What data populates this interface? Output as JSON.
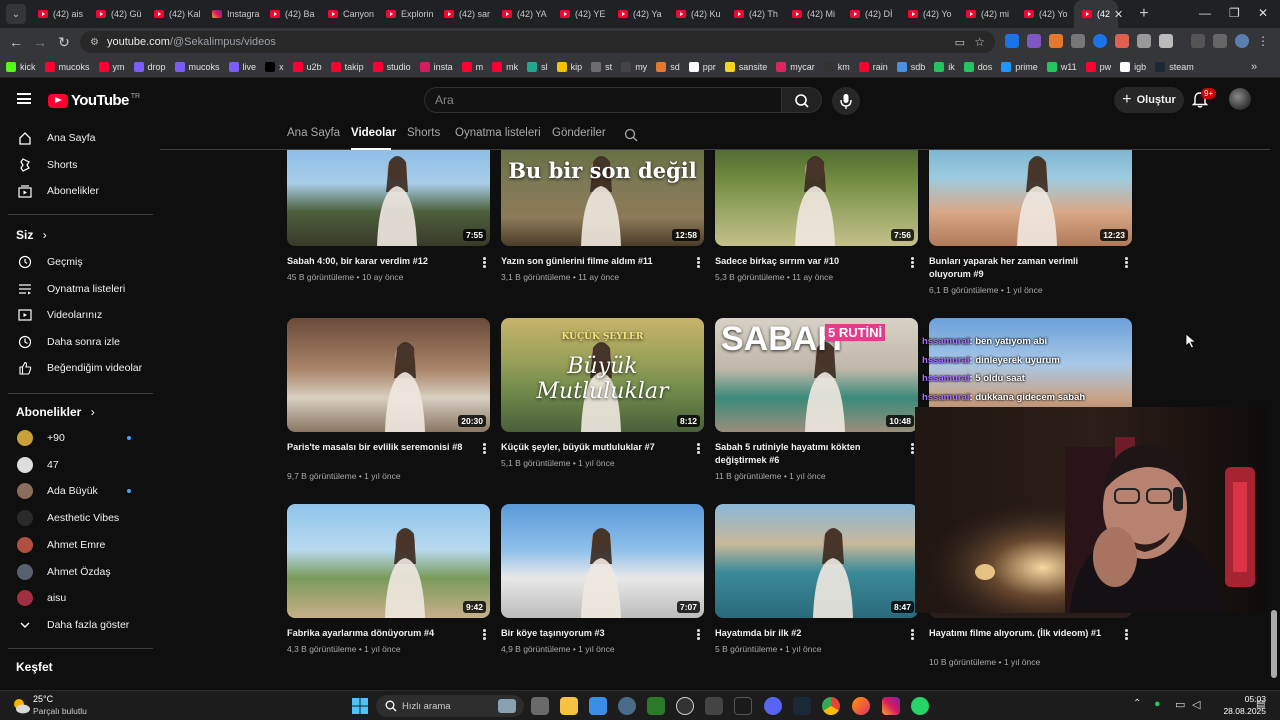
{
  "browser": {
    "tabs": [
      {
        "title": "(42) ais",
        "icon": "youtube"
      },
      {
        "title": "(42) Gü",
        "icon": "youtube"
      },
      {
        "title": "(42) Kal",
        "icon": "youtube"
      },
      {
        "title": "Instagra",
        "icon": "instagram"
      },
      {
        "title": "(42) Ba",
        "icon": "youtube"
      },
      {
        "title": "Canyon",
        "icon": "youtube"
      },
      {
        "title": "Explorin",
        "icon": "youtube"
      },
      {
        "title": "(42) sar",
        "icon": "youtube"
      },
      {
        "title": "(42) YA",
        "icon": "youtube"
      },
      {
        "title": "(42) YE",
        "icon": "youtube"
      },
      {
        "title": "(42) Ya",
        "icon": "youtube"
      },
      {
        "title": "(42) Ku",
        "icon": "youtube"
      },
      {
        "title": "(42) Th",
        "icon": "youtube"
      },
      {
        "title": "(42) Mi",
        "icon": "youtube"
      },
      {
        "title": "(42) Dİ",
        "icon": "youtube"
      },
      {
        "title": "(42) Yo",
        "icon": "youtube"
      },
      {
        "title": "(42) mi",
        "icon": "youtube"
      },
      {
        "title": "(42) Yo",
        "icon": "youtube"
      }
    ],
    "active_tab": {
      "title": "(42"
    },
    "url_host": "youtube.com",
    "url_path": "/@Sekalimpus/videos",
    "bookmarks": [
      {
        "label": "kick",
        "color": "#53fc18"
      },
      {
        "label": "mucoks",
        "color": "#ff0033"
      },
      {
        "label": "ym",
        "color": "#ff0033"
      },
      {
        "label": "drop",
        "color": "#7a5cff"
      },
      {
        "label": "mucoks",
        "color": "#7a5cff"
      },
      {
        "label": "live",
        "color": "#7a5cff"
      },
      {
        "label": "x",
        "color": "#000000"
      },
      {
        "label": "u2b",
        "color": "#ff0033"
      },
      {
        "label": "takip",
        "color": "#ff0033"
      },
      {
        "label": "studio",
        "color": "#ff0033"
      },
      {
        "label": "insta",
        "color": "#d81b60"
      },
      {
        "label": "m",
        "color": "#ff0033"
      },
      {
        "label": "mk",
        "color": "#ff0033"
      },
      {
        "label": "sl",
        "color": "#1faa8f"
      },
      {
        "label": "kip",
        "color": "#f5c400"
      },
      {
        "label": "st",
        "color": "#6e6e6e"
      },
      {
        "label": "my",
        "color": "#444444"
      },
      {
        "label": "sd",
        "color": "#e8772e"
      },
      {
        "label": "ppr",
        "color": "#ffffff"
      },
      {
        "label": "sansite",
        "color": "#f7d51d"
      },
      {
        "label": "mycar",
        "color": "#e0245e"
      },
      {
        "label": "km",
        "color": "#333333"
      },
      {
        "label": "rain",
        "color": "#ff0033"
      },
      {
        "label": "sdb",
        "color": "#4a90e2"
      },
      {
        "label": "ik",
        "color": "#22c55e"
      },
      {
        "label": "dos",
        "color": "#22c55e"
      },
      {
        "label": "prime",
        "color": "#1a98ff"
      },
      {
        "label": "w11",
        "color": "#22c55e"
      },
      {
        "label": "pw",
        "color": "#ff0033"
      },
      {
        "label": "igb",
        "color": "#ffffff"
      },
      {
        "label": "steam",
        "color": "#1b2838"
      }
    ]
  },
  "yt": {
    "logo_text": "YouTube",
    "country": "TR",
    "search_placeholder": "Ara",
    "create_label": "Oluştur",
    "notif_badge": "9+"
  },
  "sidebar": {
    "main": [
      {
        "label": "Ana Sayfa",
        "icon": "home-icon"
      },
      {
        "label": "Shorts",
        "icon": "shorts-icon"
      },
      {
        "label": "Abonelikler",
        "icon": "subscriptions-icon"
      }
    ],
    "you_header": "Siz",
    "you": [
      {
        "label": "Geçmiş",
        "icon": "history-icon"
      },
      {
        "label": "Oynatma listeleri",
        "icon": "playlists-icon"
      },
      {
        "label": "Videolarınız",
        "icon": "your-videos-icon"
      },
      {
        "label": "Daha sonra izle",
        "icon": "watch-later-icon"
      },
      {
        "label": "Beğendiğim videolar",
        "icon": "liked-icon"
      }
    ],
    "subs_header": "Abonelikler",
    "subs": [
      {
        "label": "+90",
        "live": true,
        "color": "#c8a13a"
      },
      {
        "label": "47",
        "live": false,
        "color": "#dddddd"
      },
      {
        "label": "Ada Büyük",
        "live": true,
        "color": "#8a6e5a"
      },
      {
        "label": "Aesthetic Vibes",
        "live": false,
        "color": "#2a2a2a"
      },
      {
        "label": "Ahmet Emre",
        "live": false,
        "color": "#b05040"
      },
      {
        "label": "Ahmet Özdaş",
        "live": false,
        "color": "#556070"
      },
      {
        "label": "aisu",
        "live": false,
        "color": "#a03040"
      }
    ],
    "show_more": "Daha fazla göster",
    "explore_header": "Keşfet"
  },
  "channel_tabs": [
    "Ana Sayfa",
    "Videolar",
    "Shorts",
    "Oynatma listeleri",
    "Gönderiler"
  ],
  "videos": [
    {
      "title": "Sabah 4:00, bir karar verdim #12",
      "views": "45 B görüntüleme",
      "age": "10 ay önce",
      "duration": "7:55",
      "thumb_text": "",
      "bg": "linear-gradient(180deg,#7fb6e6 0%,#a8cde8 45%,#4b5f3a 70%,#3a3a2a 100%)"
    },
    {
      "title": "Yazın son günlerini filme aldım #11",
      "views": "3,1 B görüntüleme",
      "age": "11 ay önce",
      "duration": "12:58",
      "thumb_text": "Bu bir son değil",
      "bg": "linear-gradient(180deg,#5b6a3a 0%,#7d7a55 45%,#8d7a58 75%,#4a3d2a 100%)"
    },
    {
      "title": "Sadece birkaç sırrım var #10",
      "views": "5,3 B görüntüleme",
      "age": "11 ay önce",
      "duration": "7:56",
      "thumb_text": "",
      "bg": "linear-gradient(180deg,#3e5a2a 0%,#6f8a3e 40%,#9aa866 70%,#c4c08a 100%)"
    },
    {
      "title": "Bunları yaparak her zaman verimli oluyorum #9",
      "views": "6,1 B görüntüleme",
      "age": "1 yıl önce",
      "duration": "12:23",
      "thumb_text": "",
      "bg": "linear-gradient(180deg,#6aa8c8 0%,#9ccbe0 40%,#d8a886 70%,#b07a5a 100%)"
    },
    {
      "title": "Paris'te masalsı bir evlilik seremonisi #8",
      "views": "9,7 B görüntüleme",
      "age": "1 yıl önce",
      "duration": "20:30",
      "thumb_text": "",
      "bg": "linear-gradient(180deg,#6a4a3a 0%,#a88468 45%,#d8cfc2 70%,#8a7664 100%)"
    },
    {
      "title": "Küçük şeyler, büyük mutluluklar #7",
      "views": "5,1 B görüntüleme",
      "age": "1 yıl önce",
      "duration": "8:12",
      "thumb_text": "Büyük Mutluluklar",
      "bg": "linear-gradient(180deg,#c8b46a 0%,#9ca25a 35%,#6e8a4a 65%,#4a5f3a 100%)"
    },
    {
      "title": "Sabah 5 rutiniyle hayatımı kökten değiştirmek #6",
      "views": "11 B görüntüleme",
      "age": "1 yıl önce",
      "duration": "10:48",
      "thumb_text": "SABAH",
      "bg": "linear-gradient(180deg,#d8d2c6 0%,#bfb7a8 45%,#3a8a7a 70%,#9a8e7a 100%)"
    },
    {
      "title": "",
      "views": "",
      "age": "",
      "duration": "",
      "thumb_text": "",
      "bg": "linear-gradient(180deg,#6aa0d8 0%,#a8c8e8 40%,#c8a486 70%,#a86a5a 100%)"
    },
    {
      "title": "Fabrika ayarlarıma dönüyorum #4",
      "views": "4,3 B görüntüleme",
      "age": "1 yıl önce",
      "duration": "9:42",
      "thumb_text": "",
      "bg": "linear-gradient(180deg,#8ec4ea 0%,#b8daf0 40%,#7a9a5a 65%,#c8b08a 100%)"
    },
    {
      "title": "Bir köye taşınıyorum #3",
      "views": "4,9 B görüntüleme",
      "age": "1 yıl önce",
      "duration": "7:07",
      "thumb_text": "",
      "bg": "linear-gradient(180deg,#5a9ad8 0%,#8ec0ea 40%,#e8e8e8 65%,#bcbcbc 100%)"
    },
    {
      "title": "Hayatımda bir ilk #2",
      "views": "5 B görüntüleme",
      "age": "1 yıl önce",
      "duration": "8:47",
      "thumb_text": "",
      "bg": "linear-gradient(180deg,#8ab8d8 0%,#c8b89a 35%,#3a8a9a 60%,#2a6a7a 100%)"
    },
    {
      "title": "Hayatımı filme alıyorum. (İlk videom) #1",
      "views": "10 B görüntüleme",
      "age": "1 yıl önce",
      "duration": "",
      "thumb_text": "",
      "bg": "linear-gradient(180deg,#3a2a24 0%,#2a1e1a 100%)"
    }
  ],
  "thumb_extra": {
    "rutini": "5 RUTİNİ",
    "kucuk": "KÜÇÜK ŞEYLER"
  },
  "chat": [
    {
      "user": "hssamurai",
      "msg": ": ben yatıyom abi"
    },
    {
      "user": "hssamurai",
      "msg": ": dinleyerek uyurum"
    },
    {
      "user": "hssamurai",
      "msg": ": 5 oldu saat"
    },
    {
      "user": "hssamurai",
      "msg": ": dükkana gidecem sabah"
    }
  ],
  "taskbar": {
    "temp": "25°C",
    "weather": "Parçalı bulutlu",
    "search": "Hızlı arama",
    "time": "05:03",
    "date": "28.08.2025"
  }
}
